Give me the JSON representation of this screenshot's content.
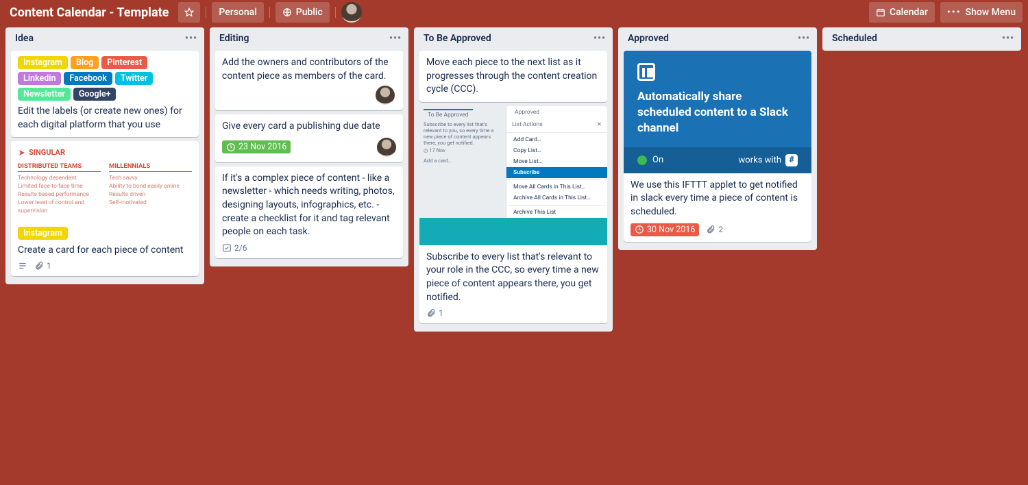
{
  "header": {
    "title": "Content Calendar - Template",
    "personal": "Personal",
    "public": "Public",
    "calendar": "Calendar",
    "show_menu": "Show Menu"
  },
  "lists": [
    {
      "title": "Idea"
    },
    {
      "title": "Editing"
    },
    {
      "title": "To Be Approved"
    },
    {
      "title": "Approved"
    },
    {
      "title": "Scheduled"
    }
  ],
  "idea": {
    "labels": [
      {
        "text": "Instagram",
        "color": "#f2d600"
      },
      {
        "text": "Blog",
        "color": "#ff9f1a"
      },
      {
        "text": "Pinterest",
        "color": "#eb5a46"
      },
      {
        "text": "Linkedin",
        "color": "#c377e0"
      },
      {
        "text": "Facebook",
        "color": "#0079bf"
      },
      {
        "text": "Twitter",
        "color": "#00c2e0"
      },
      {
        "text": "Newsletter",
        "color": "#51e898"
      },
      {
        "text": "Google+",
        "color": "#344563"
      }
    ],
    "card1_text": "Edit the labels (or create new ones) for each digital platform that you use",
    "card2_text": "Create a card for each piece of content",
    "card2_label": {
      "text": "Instagram",
      "color": "#f2d600"
    },
    "card2_attachments": "1",
    "singular": {
      "brand": "SINGULAR",
      "col1_head": "DISTRIBUTED TEAMS",
      "col1": [
        "Technology dependent",
        "Limited face-to-face time",
        "Results based performance",
        "Lower level of control and supervision"
      ],
      "col2_head": "MILLENNIALS",
      "col2": [
        "Tech savvy",
        "Ability to bond easily online",
        "Results driven",
        "Self-motivated"
      ]
    }
  },
  "editing": {
    "card1": "Add the owners and contributors of the content piece as members of the card.",
    "card2": "Give every card a publishing due date",
    "card2_date": "23 Nov 2016",
    "card3": "If it's a complex piece of content - like a newsletter - which needs writing, photos, designing layouts, infographics, etc. - create a checklist for it and tag relevant people on each task.",
    "card3_check": "2/6"
  },
  "tba": {
    "card1": "Move each piece to the next list as it progresses through the content creation cycle (CCC).",
    "card2": "Subscribe to every list that's relevant to your role in the CCC, so every time a new piece of content appears there, you get notified.",
    "card2_attachments": "1",
    "cover": {
      "tab1": "To Be Approved",
      "tab2": "Approved",
      "mini": "Subscribe to every list that's relevant to you, so every time a new piece of content appears there, you get notified.",
      "mini_date": "17 Nov",
      "add_card": "Add a card…",
      "menu_head": "List Actions",
      "menu": [
        "Add Card…",
        "Copy List…",
        "Move List…",
        "Subscribe",
        "Move All Cards in This List…",
        "Archive All Cards in This List…",
        "Archive This List"
      ]
    }
  },
  "approved": {
    "cover_title": "Automatically share scheduled content to a Slack channel",
    "on": "On",
    "works": "works with",
    "card_text": "We use this IFTTT applet to get notified in slack every time a piece of content is scheduled.",
    "date": "30 Nov 2016",
    "attachments": "2"
  }
}
